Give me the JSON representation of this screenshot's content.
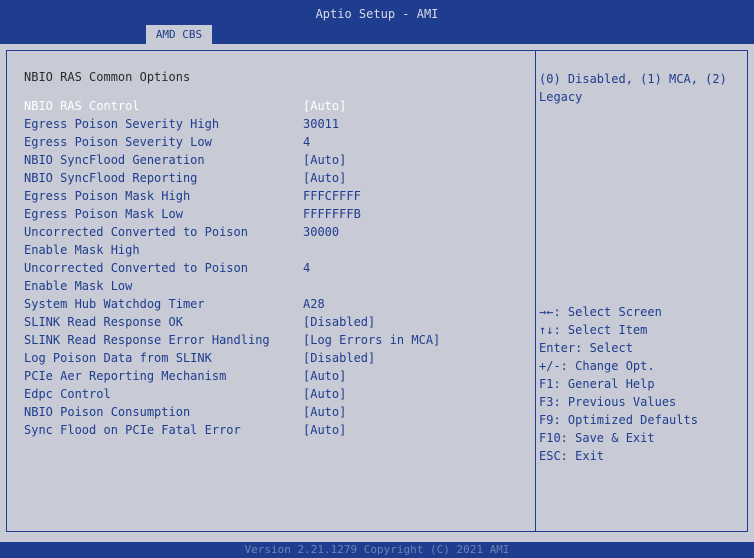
{
  "app": {
    "title": "Aptio Setup - AMI",
    "tab": "AMD CBS"
  },
  "main": {
    "heading": "NBIO RAS Common Options",
    "items": [
      {
        "label": "NBIO RAS Control",
        "value": "[Auto]"
      },
      {
        "label": "Egress Poison Severity High",
        "value": "30011"
      },
      {
        "label": "Egress Poison Severity Low",
        "value": "4"
      },
      {
        "label": "NBIO SyncFlood Generation",
        "value": "[Auto]"
      },
      {
        "label": "NBIO SyncFlood Reporting",
        "value": "[Auto]"
      },
      {
        "label": "Egress Poison Mask High",
        "value": "FFFCFFFF"
      },
      {
        "label": "Egress Poison Mask Low",
        "value": "FFFFFFFB"
      },
      {
        "label": "Uncorrected Converted to Poison",
        "value": "30000"
      },
      {
        "label": "Enable Mask High",
        "value": ""
      },
      {
        "label": "Uncorrected Converted to Poison",
        "value": "4"
      },
      {
        "label": "Enable Mask Low",
        "value": ""
      },
      {
        "label": "System Hub Watchdog Timer",
        "value": "A28"
      },
      {
        "label": "SLINK Read Response OK",
        "value": "[Disabled]"
      },
      {
        "label": "SLINK Read Response Error Handling",
        "value": "[Log Errors in MCA]"
      },
      {
        "label": "Log Poison Data from SLINK",
        "value": "[Disabled]"
      },
      {
        "label": "PCIe Aer Reporting Mechanism",
        "value": "[Auto]"
      },
      {
        "label": "Edpc Control",
        "value": "[Auto]"
      },
      {
        "label": "NBIO Poison Consumption",
        "value": "[Auto]"
      },
      {
        "label": "Sync Flood on PCIe Fatal Error",
        "value": "[Auto]"
      }
    ]
  },
  "help": {
    "text": "(0) Disabled, (1) MCA, (2) Legacy",
    "keys": [
      "→←: Select Screen",
      "↑↓: Select Item",
      "Enter: Select",
      "+/-: Change Opt.",
      "F1: General Help",
      "F3: Previous Values",
      "F9: Optimized Defaults",
      "F10: Save & Exit",
      "ESC: Exit"
    ]
  },
  "footer": {
    "version": "Version 2.21.1279 Copyright (C) 2021 AMI"
  },
  "colors": {
    "background": "#1e3d8f",
    "panel": "#c8cbd5",
    "text": "#1e3d8f",
    "selected": "#ffffff"
  }
}
